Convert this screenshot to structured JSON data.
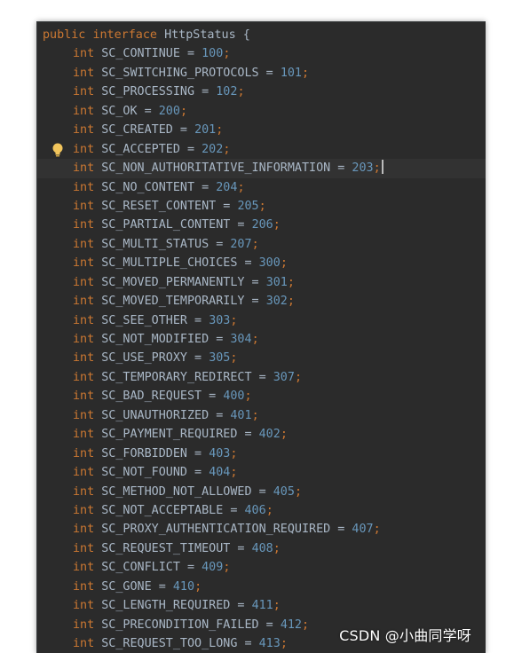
{
  "header": {
    "kw_public": "public",
    "kw_interface": "interface",
    "name": "HttpStatus",
    "brace": "{"
  },
  "type_keyword": "int",
  "fields": [
    {
      "name": "SC_CONTINUE",
      "value": "100"
    },
    {
      "name": "SC_SWITCHING_PROTOCOLS",
      "value": "101"
    },
    {
      "name": "SC_PROCESSING",
      "value": "102"
    },
    {
      "name": "SC_OK",
      "value": "200"
    },
    {
      "name": "SC_CREATED",
      "value": "201"
    },
    {
      "name": "SC_ACCEPTED",
      "value": "202"
    },
    {
      "name": "SC_NON_AUTHORITATIVE_INFORMATION",
      "value": "203"
    },
    {
      "name": "SC_NO_CONTENT",
      "value": "204"
    },
    {
      "name": "SC_RESET_CONTENT",
      "value": "205"
    },
    {
      "name": "SC_PARTIAL_CONTENT",
      "value": "206"
    },
    {
      "name": "SC_MULTI_STATUS",
      "value": "207"
    },
    {
      "name": "SC_MULTIPLE_CHOICES",
      "value": "300"
    },
    {
      "name": "SC_MOVED_PERMANENTLY",
      "value": "301"
    },
    {
      "name": "SC_MOVED_TEMPORARILY",
      "value": "302"
    },
    {
      "name": "SC_SEE_OTHER",
      "value": "303"
    },
    {
      "name": "SC_NOT_MODIFIED",
      "value": "304"
    },
    {
      "name": "SC_USE_PROXY",
      "value": "305"
    },
    {
      "name": "SC_TEMPORARY_REDIRECT",
      "value": "307"
    },
    {
      "name": "SC_BAD_REQUEST",
      "value": "400"
    },
    {
      "name": "SC_UNAUTHORIZED",
      "value": "401"
    },
    {
      "name": "SC_PAYMENT_REQUIRED",
      "value": "402"
    },
    {
      "name": "SC_FORBIDDEN",
      "value": "403"
    },
    {
      "name": "SC_NOT_FOUND",
      "value": "404"
    },
    {
      "name": "SC_METHOD_NOT_ALLOWED",
      "value": "405"
    },
    {
      "name": "SC_NOT_ACCEPTABLE",
      "value": "406"
    },
    {
      "name": "SC_PROXY_AUTHENTICATION_REQUIRED",
      "value": "407"
    },
    {
      "name": "SC_REQUEST_TIMEOUT",
      "value": "408"
    },
    {
      "name": "SC_CONFLICT",
      "value": "409"
    },
    {
      "name": "SC_GONE",
      "value": "410"
    },
    {
      "name": "SC_LENGTH_REQUIRED",
      "value": "411"
    },
    {
      "name": "SC_PRECONDITION_FAILED",
      "value": "412"
    },
    {
      "name": "SC_REQUEST_TOO_LONG",
      "value": "413"
    }
  ],
  "bulb_line_index": 5,
  "current_line_index": 6,
  "watermark": "CSDN @小曲同学呀",
  "colors": {
    "background": "#2b2b2b",
    "keyword": "#cc7832",
    "number": "#6897bb",
    "identifier": "#a9b7c6",
    "current_line": "#323232",
    "bulb": "#f2c55c"
  },
  "icons": {
    "bulb": "intention-bulb-icon"
  }
}
